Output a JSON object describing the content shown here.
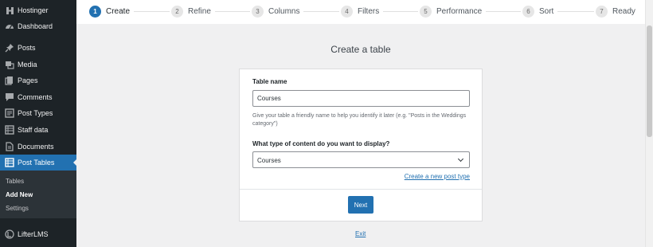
{
  "sidebar": {
    "items": [
      {
        "label": "Hostinger",
        "icon": "hostinger-logo-icon"
      },
      {
        "label": "Dashboard",
        "icon": "dashboard-icon"
      },
      {
        "label": "Posts",
        "icon": "pin-icon"
      },
      {
        "label": "Media",
        "icon": "media-icon"
      },
      {
        "label": "Pages",
        "icon": "pages-icon"
      },
      {
        "label": "Comments",
        "icon": "comment-icon"
      },
      {
        "label": "Post Types",
        "icon": "post-types-icon"
      },
      {
        "label": "Staff data",
        "icon": "table-icon"
      },
      {
        "label": "Documents",
        "icon": "document-icon"
      },
      {
        "label": "Post Tables",
        "icon": "grid-icon"
      },
      {
        "label": "LifterLMS",
        "icon": "lifterlms-icon"
      }
    ],
    "submenu": [
      "Tables",
      "Add New",
      "Settings"
    ],
    "active_color": "#2271b1"
  },
  "steps": [
    {
      "num": "1",
      "label": "Create"
    },
    {
      "num": "2",
      "label": "Refine"
    },
    {
      "num": "3",
      "label": "Columns"
    },
    {
      "num": "4",
      "label": "Filters"
    },
    {
      "num": "5",
      "label": "Performance"
    },
    {
      "num": "6",
      "label": "Sort"
    },
    {
      "num": "7",
      "label": "Ready"
    }
  ],
  "main": {
    "title": "Create a table",
    "table_name_label": "Table name",
    "table_name_value": "Courses",
    "table_name_help": "Give your table a friendly name to help you identify it later (e.g. \"Posts in the Weddings category\")",
    "content_type_label": "What type of content do you want to display?",
    "content_type_value": "Courses",
    "create_post_type_link": "Create a new post type",
    "next_button": "Next",
    "exit_link": "Exit"
  }
}
